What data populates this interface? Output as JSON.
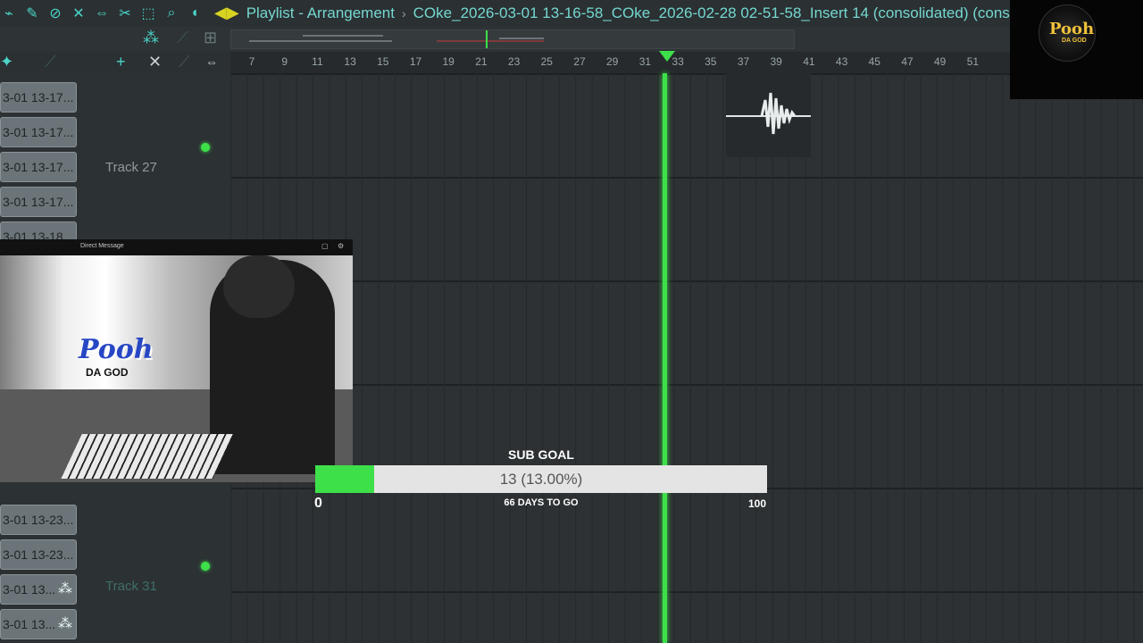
{
  "toolbar": {
    "icons": [
      "magnet-icon",
      "paint-icon",
      "delete-icon",
      "mute-icon",
      "slip-icon",
      "slice-icon",
      "select-icon",
      "zoom-icon",
      "playback-icon"
    ],
    "title": "Playlist - Arrangement",
    "separator": "›",
    "file": "COke_2026-03-01 13-16-58_COke_2026-02-28 02-51-58_Insert 14 (consolidated) (cons"
  },
  "ruler": {
    "marks": [
      "7",
      "9",
      "11",
      "13",
      "15",
      "17",
      "19",
      "21",
      "23",
      "25",
      "27",
      "29",
      "31",
      "33",
      "35",
      "37",
      "39",
      "41",
      "43",
      "45",
      "47",
      "49",
      "51"
    ]
  },
  "clips": [
    {
      "label": "3-01 13-17..."
    },
    {
      "label": "3-01 13-17..."
    },
    {
      "label": "3-01 13-17..."
    },
    {
      "label": "3-01 13-17..."
    },
    {
      "label": "3-01 13-18"
    },
    {
      "label": "3-01 13-23..."
    },
    {
      "label": "3-01 13-23..."
    },
    {
      "label": "3-01 13..."
    },
    {
      "label": "3-01 13..."
    }
  ],
  "tracks": {
    "track_27": "Track 27",
    "track_31": "Track 31"
  },
  "webcam": {
    "title": "Direct Message",
    "decal": "Pooh",
    "decal_sub": "DA GOD"
  },
  "logo": {
    "text": "Pooh",
    "sub": "DA GOD"
  },
  "sub_goal": {
    "title": "SUB GOAL",
    "value_text": "13 (13.00%)",
    "progress": 0.13,
    "min": "0",
    "max": "100",
    "days_left": "66 DAYS TO GO"
  },
  "colors": {
    "accent": "#4ad6c8",
    "playhead": "#3ee04a",
    "title": "#74d7cf"
  }
}
